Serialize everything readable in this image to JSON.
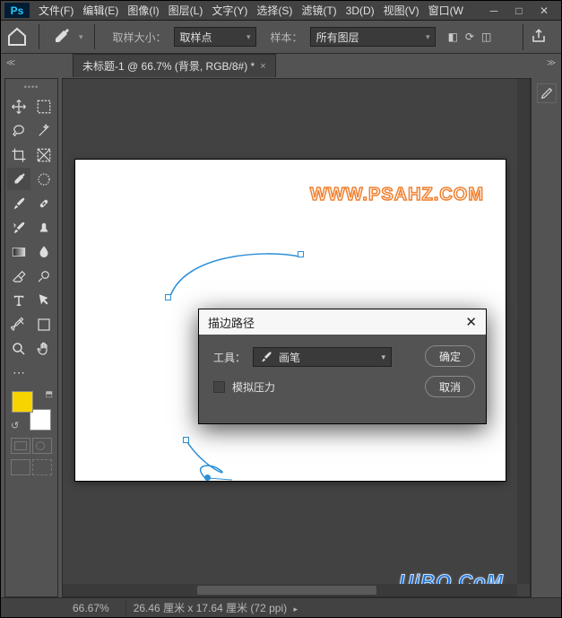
{
  "app": {
    "logo": "Ps"
  },
  "menu": {
    "file": "文件(F)",
    "edit": "编辑(E)",
    "image": "图像(I)",
    "layer": "图层(L)",
    "type": "文字(Y)",
    "select": "选择(S)",
    "filter": "滤镜(T)",
    "threeD": "3D(D)",
    "view": "视图(V)",
    "window": "窗口(W"
  },
  "options": {
    "sample_size_label": "取样大小：",
    "sample_size_value": "取样点",
    "sample_label": "样本：",
    "sample_value": "所有图层"
  },
  "tab": {
    "title": "未标题-1 @ 66.7% (背景, RGB/8#) *"
  },
  "dialog": {
    "title": "描边路径",
    "tool_label": "工具：",
    "tool_value": "画笔",
    "simulate_pressure": "模拟压力",
    "ok": "确定",
    "cancel": "取消"
  },
  "status": {
    "zoom": "66.67%",
    "dimensions": "26.46 厘米 x 17.64 厘米 (72 ppi)"
  },
  "watermark": {
    "w1": "WWW.PSAHZ.COM",
    "w2": "UiBQ.CoM"
  },
  "colors": {
    "foreground": "#f7d400",
    "background": "#ffffff",
    "accent": "#2c8fd6"
  }
}
